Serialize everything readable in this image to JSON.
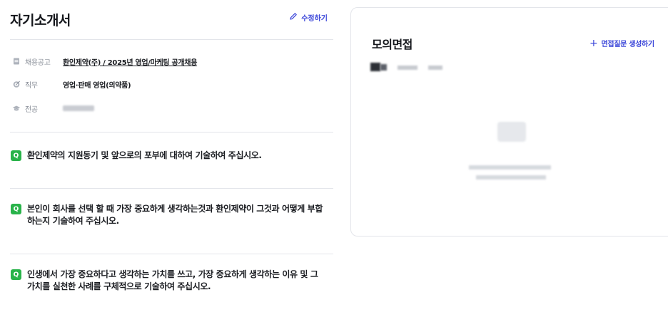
{
  "resume": {
    "title": "자기소개서",
    "edit_label": "수정하기",
    "info": [
      {
        "icon": "document-icon",
        "label": "채용공고",
        "value": "환인제약(주) / 2025년 영업/마케팅 공개채용"
      },
      {
        "icon": "target-icon",
        "label": "직무",
        "value": "영업·판매 영업(의약품)"
      },
      {
        "icon": "graduation-cap-icon",
        "label": "전공",
        "value": ""
      }
    ],
    "question_badge": "Q",
    "questions": [
      {
        "text": "환인제약의 지원동기 및 앞으로의 포부에 대하여 기술하여 주십시오."
      },
      {
        "text": "본인이 회사를 선택 할 때 가장 중요하게 생각하는것과 환인제약이 그것과 어떻게 부합하는지 기술하여 주십시오."
      },
      {
        "text": "인생에서 가장 중요하다고 생각하는 가치를 쓰고, 가장 중요하게 생각하는 이유 및 그 가치를 실천한 사례를 구체적으로 기술하여 주십시오."
      }
    ]
  },
  "interview": {
    "title": "모의면접",
    "generate_label": "면접질문 생성하기"
  },
  "colors": {
    "accent": "#3b46d9",
    "badge": "#29b34a",
    "divider": "#e3e5ea",
    "muted": "#8a8f99"
  }
}
